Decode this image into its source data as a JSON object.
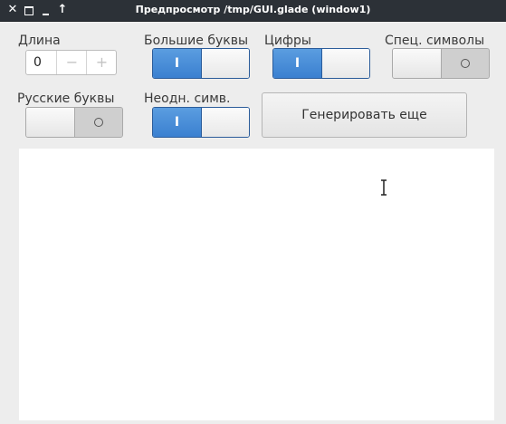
{
  "window": {
    "title": "Предпросмотр /tmp/GUI.glade (window1)",
    "controls": {
      "close": "✕",
      "maximize": "□",
      "minimize": "‗",
      "shade": "↑"
    }
  },
  "fields": {
    "length_label": "Длина",
    "length_value": "0",
    "minus": "−",
    "plus": "+",
    "uppercase_label": "Большие буквы",
    "digits_label": "Цифры",
    "special_label": "Спец. символы",
    "russian_label": "Русские буквы",
    "ambiguous_label": "Неодн. симв.",
    "switch_on_glyph": "I"
  },
  "switches": {
    "uppercase": true,
    "digits": true,
    "special": false,
    "russian": false,
    "ambiguous": true
  },
  "generate_button": "Генерировать еще",
  "output_text": ""
}
